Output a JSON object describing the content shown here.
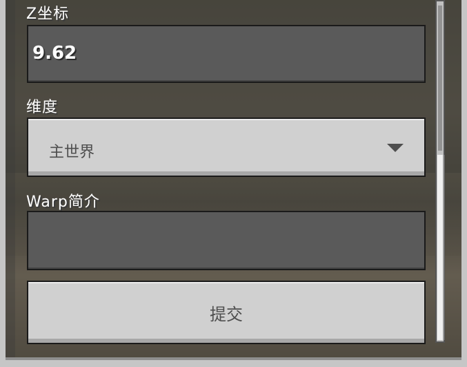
{
  "form": {
    "z_label": "Z坐标",
    "z_value": "9.62",
    "dimension_label": "维度",
    "dimension_selected": "主世界",
    "description_label": "Warp简介",
    "description_value": "",
    "submit_label": "提交"
  },
  "colors": {
    "panel_border": "#c6c6c6",
    "field_bg": "#5a5a5a",
    "button_bg": "#d0d0d0",
    "label_text": "#ffffff",
    "button_text": "#4e4e4e"
  },
  "icons": {
    "dropdown_arrow": "chevron-down-icon"
  }
}
